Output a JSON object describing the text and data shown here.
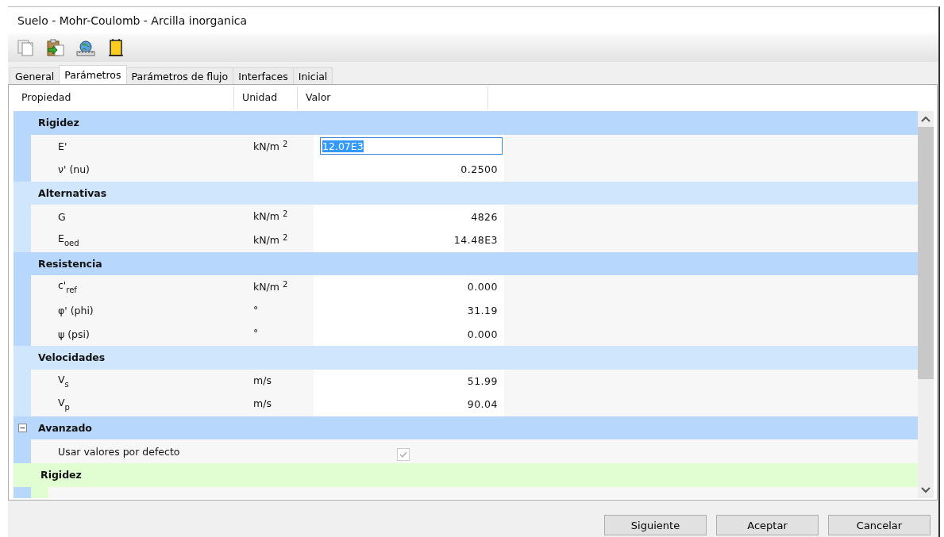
{
  "window": {
    "title": "Suelo - Mohr-Coulomb - Arcilla inorganica"
  },
  "toolbar": [
    {
      "kind": "copy"
    },
    {
      "kind": "paste"
    },
    {
      "kind": "globe"
    },
    {
      "kind": "column"
    }
  ],
  "tabs": [
    {
      "label": "General",
      "selected": false
    },
    {
      "label": "Parámetros",
      "selected": true
    },
    {
      "label": "Parámetros de flujo",
      "selected": false
    },
    {
      "label": "Interfaces",
      "selected": false
    },
    {
      "label": "Inicial",
      "selected": false
    }
  ],
  "table": {
    "columns": [
      "Propiedad",
      "Unidad",
      "Valor"
    ],
    "groups": [
      {
        "title": "Rigidez",
        "color": "#b7d7fd",
        "kind": "group",
        "rows": [
          {
            "kind": "value",
            "name": "E'",
            "unit": "kN/m $^{2}$",
            "value": "12.07E3",
            "editing": true
          },
          {
            "kind": "value",
            "name": "ν' (nu)",
            "value": "0.2500",
            "editing": false
          }
        ]
      },
      {
        "title": "Alternativas",
        "color": "#d0e6fd",
        "kind": "group",
        "rows": [
          {
            "kind": "value",
            "name": "G",
            "unit": "kN/m $^{2}$",
            "value": "4826",
            "editing": false
          },
          {
            "kind": "value",
            "name": "E$_{oed}$",
            "unit": "kN/m $^{2}$",
            "value": "14.48E3",
            "editing": false
          }
        ]
      },
      {
        "title": "Resistencia",
        "color": "#b7d7fd",
        "kind": "group",
        "rows": [
          {
            "kind": "value",
            "name": "c'$_{ref}$",
            "unit": "kN/m $^{2}$",
            "value": "0.000",
            "editing": false
          },
          {
            "kind": "value",
            "name": "φ' (phi)",
            "unit": "°",
            "value": "31.19",
            "editing": false
          },
          {
            "kind": "value",
            "name": "ψ (psi)",
            "unit": "°",
            "value": "0.000",
            "editing": false
          }
        ]
      },
      {
        "title": "Velocidades",
        "color": "#d0e6fd",
        "kind": "group",
        "rows": [
          {
            "kind": "value",
            "name": "V$_{s}$",
            "unit": "m/s",
            "value": "51.99",
            "editing": false
          },
          {
            "kind": "value",
            "name": "V$_{p}$",
            "unit": "m/s",
            "value": "90.04",
            "editing": false
          }
        ]
      },
      {
        "title": "Avanzado",
        "color": "#b7d7fd",
        "kind": "collapsible",
        "expanded": true,
        "rows": [
          {
            "kind": "checkbox",
            "name": "Usar valores por defecto",
            "checked": true,
            "disabled": true
          }
        ],
        "children": [
          {
            "title": "Rigidez",
            "color": "#e1fdd2"
          }
        ]
      }
    ]
  },
  "buttons": [
    "Siguiente",
    "Aceptar",
    "Cancelar"
  ]
}
